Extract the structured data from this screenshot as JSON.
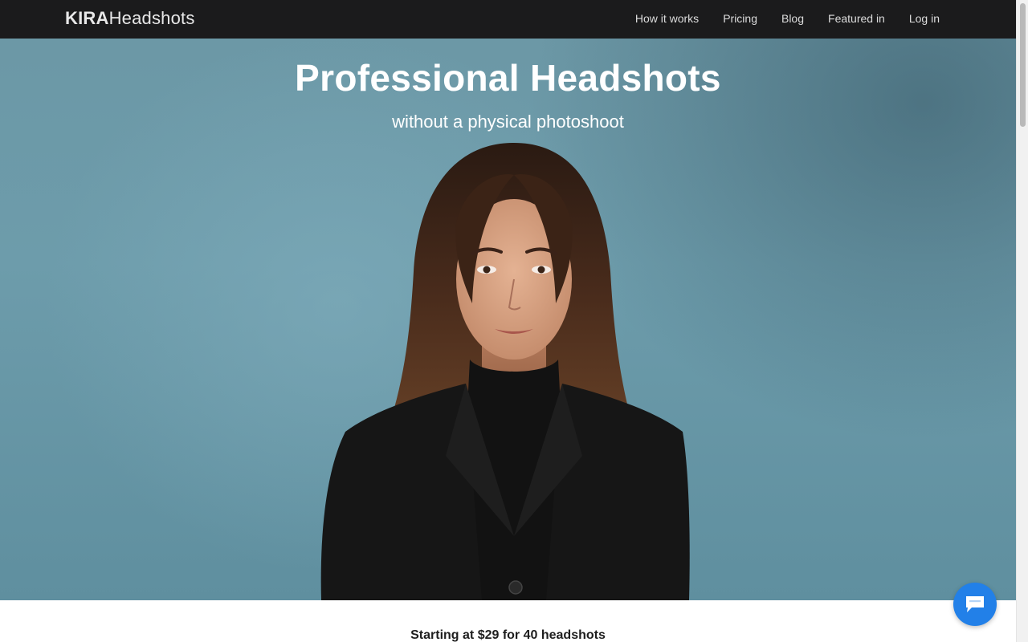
{
  "header": {
    "logo_strong": "KIRA",
    "logo_light": "Headshots",
    "nav": [
      {
        "label": "How it works"
      },
      {
        "label": "Pricing"
      },
      {
        "label": "Blog"
      },
      {
        "label": "Featured in"
      },
      {
        "label": "Log in"
      }
    ]
  },
  "hero": {
    "title": "Professional Headshots",
    "subtitle": "without a physical photoshoot",
    "image_alt": "headshot-photo"
  },
  "offer": {
    "text": "Starting at $29 for 40 headshots"
  },
  "chat_widget": {
    "icon": "chat-bubble-icon"
  },
  "colors": {
    "nav_bg": "#1b1b1c",
    "hero_bg": "#6d9cab",
    "chat_button": "#2280e8"
  }
}
